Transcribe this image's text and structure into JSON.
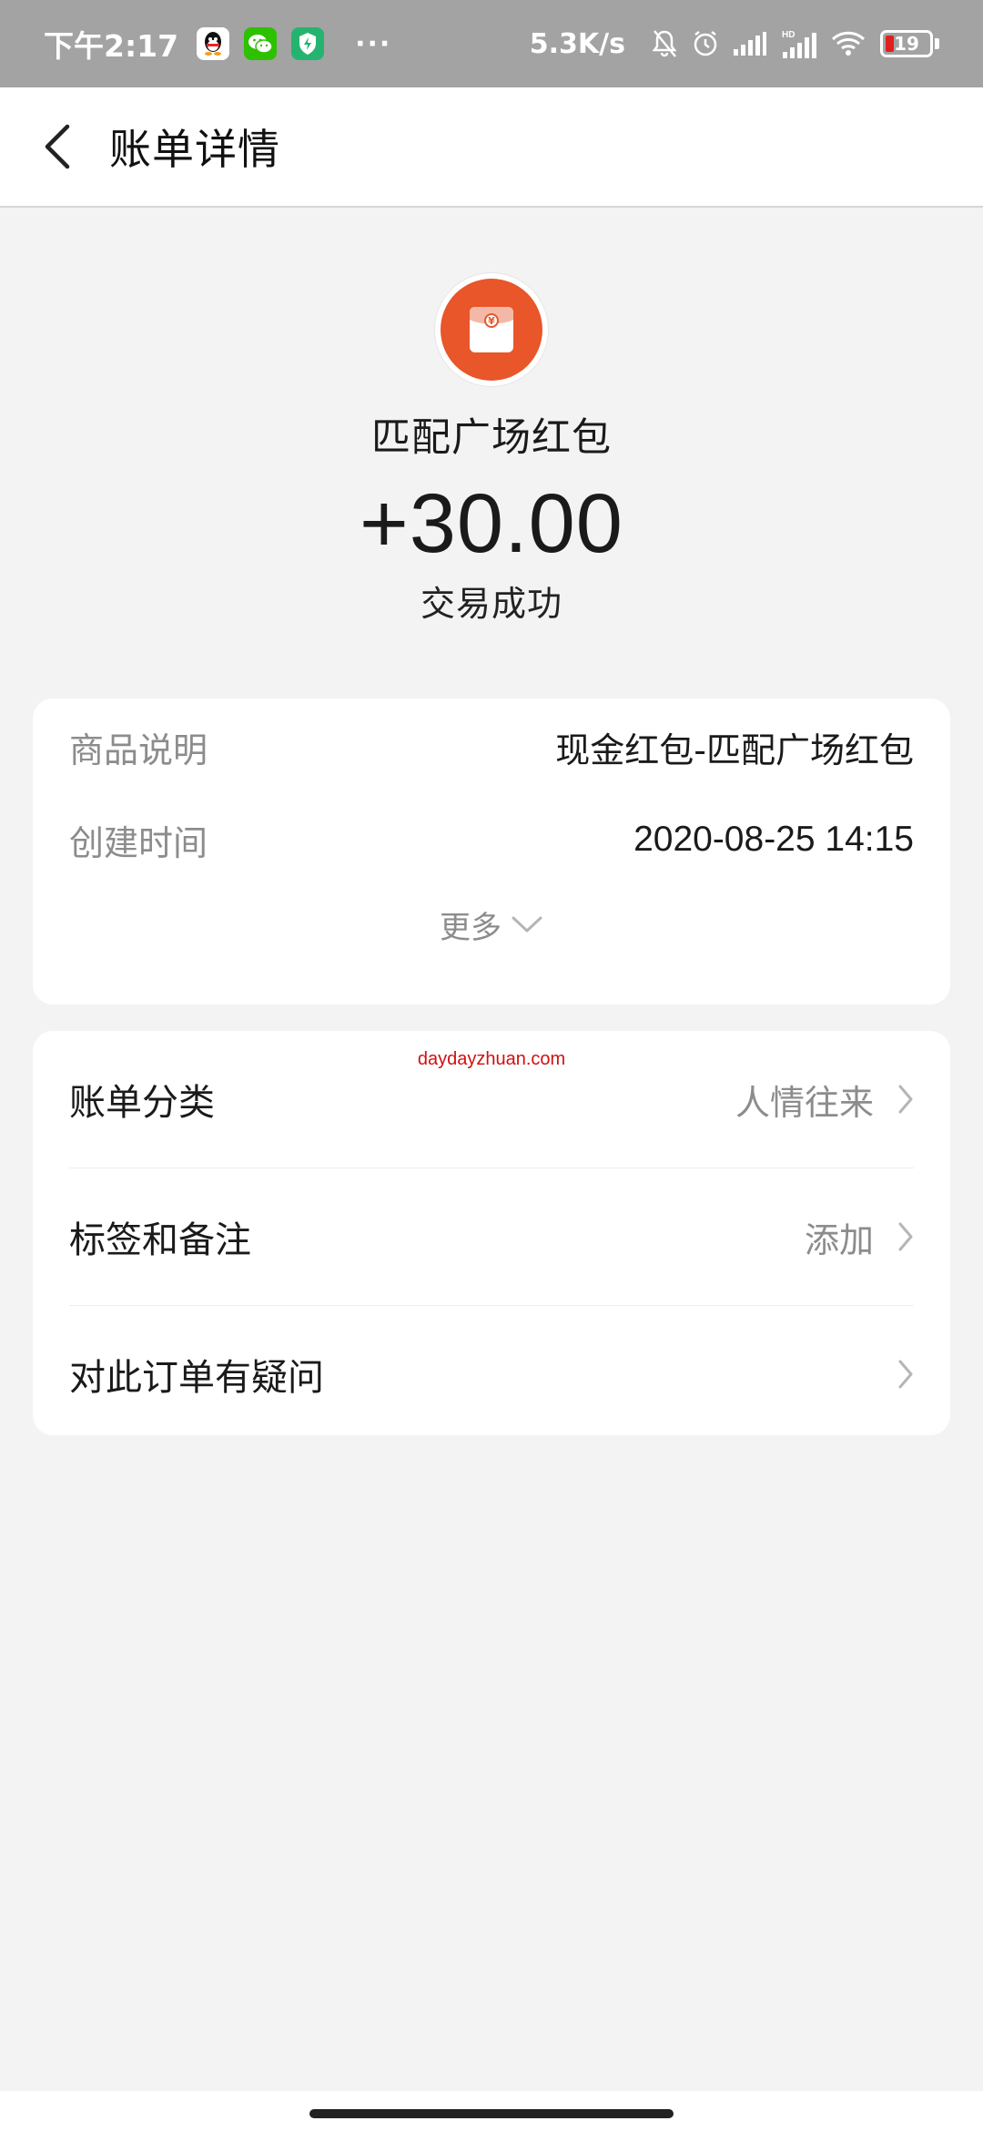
{
  "status_bar": {
    "time": "下午2:17",
    "dots": "···",
    "net_speed": "5.3K/s",
    "network_label": "HD",
    "battery_level": "19",
    "battery_fraction": 0.19,
    "apps": [
      "qq-icon",
      "wechat-icon",
      "security-shield-icon"
    ]
  },
  "header": {
    "title": "账单详情",
    "back_icon": "chevron-left-icon"
  },
  "transaction": {
    "merchant_name": "匹配广场红包",
    "logo_icon": "red-packet-icon",
    "logo_color": "#e8562a",
    "amount": "+30.00",
    "status": "交易成功"
  },
  "details": {
    "rows": [
      {
        "label": "商品说明",
        "value": "现金红包-匹配广场红包"
      },
      {
        "label": "创建时间",
        "value": "2020-08-25 14:15"
      }
    ],
    "more_label": "更多"
  },
  "menu": {
    "rows": [
      {
        "label": "账单分类",
        "value": "人情往来"
      },
      {
        "label": "标签和备注",
        "value": "添加"
      },
      {
        "label": "对此订单有疑问",
        "value": ""
      }
    ]
  },
  "watermark": "daydayzhuan.com",
  "colors": {
    "status_bar_bg": "#a3a3a3",
    "page_bg": "#f3f3f3",
    "battery_low": "#e02020",
    "watermark": "#d01010"
  }
}
